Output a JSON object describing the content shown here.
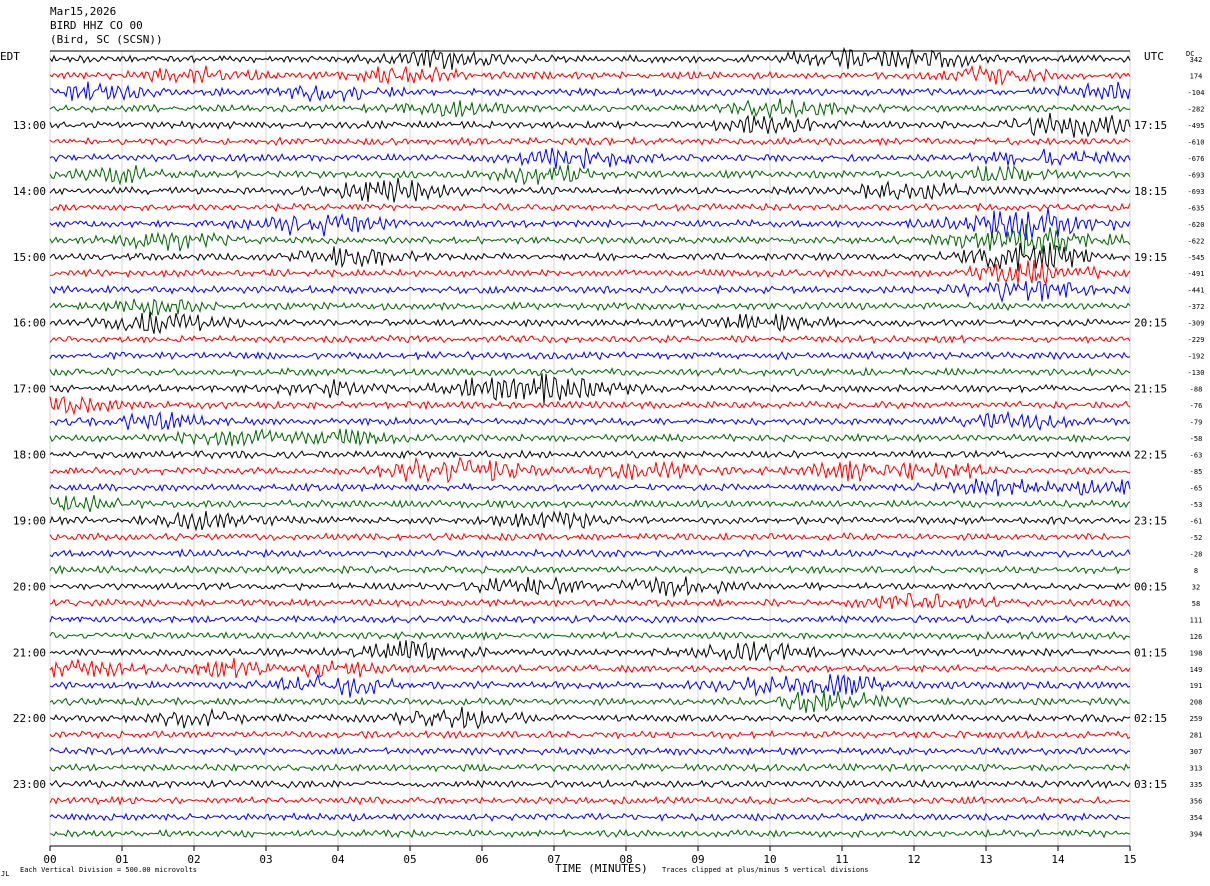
{
  "header": {
    "date": "Mar15,2026",
    "station": "BIRD HHZ CO 00",
    "location": "(Bird, SC (SCSN))"
  },
  "left_zone": "EDT",
  "right_zone": "UTC",
  "dc_label": "DC",
  "footer": {
    "left": "Each Vertical Division =  500.00 microvolts",
    "right": "Traces clipped at plus/minus 5 vertical divisions"
  },
  "mark": "JL",
  "colors": {
    "black": "#000000",
    "red": "#ff0000",
    "blue": "#0000ff",
    "green": "#006400",
    "grid": "#bbbbbb"
  },
  "chart_data": {
    "type": "line",
    "title": "",
    "xlabel": "TIME (MINUTES)",
    "xlim": [
      0,
      15
    ],
    "x_ticks": [
      "00",
      "01",
      "02",
      "03",
      "04",
      "05",
      "06",
      "07",
      "08",
      "09",
      "10",
      "11",
      "12",
      "13",
      "14",
      "15"
    ],
    "traces_per_hour": 4,
    "trace_minutes": 15,
    "trace_color_cycle": [
      "black",
      "red",
      "blue",
      "green"
    ],
    "left_hour_labels": [
      "13:00",
      "14:00",
      "15:00",
      "16:00",
      "17:00",
      "18:00",
      "19:00",
      "20:00",
      "21:00",
      "22:00",
      "23:00"
    ],
    "right_hour_labels": [
      "17:15",
      "18:15",
      "19:15",
      "20:15",
      "21:15",
      "22:15",
      "23:15",
      "00:15",
      "01:15",
      "02:15",
      "03:15"
    ],
    "dc_offsets": [
      342,
      174,
      -104,
      -282,
      -495,
      -610,
      -676,
      -693,
      -693,
      -635,
      -620,
      -622,
      -545,
      -491,
      -441,
      -372,
      -309,
      -229,
      -192,
      -130,
      -88,
      -76,
      -79,
      -58,
      -63,
      -85,
      -65,
      -53,
      -61,
      -52,
      -28,
      8,
      32,
      58,
      111,
      126,
      198,
      149,
      191,
      208,
      259,
      281,
      307,
      313,
      335,
      356,
      354,
      394
    ],
    "bursts": [
      {
        "trace": 0,
        "minute": 5.5,
        "strength": 1.6
      },
      {
        "trace": 0,
        "minute": 11.0,
        "strength": 1.7
      },
      {
        "trace": 0,
        "minute": 12.3,
        "strength": 1.3
      },
      {
        "trace": 1,
        "minute": 2.0,
        "strength": 1.3
      },
      {
        "trace": 1,
        "minute": 4.9,
        "strength": 1.4
      },
      {
        "trace": 1,
        "minute": 13.1,
        "strength": 1.5
      },
      {
        "trace": 2,
        "minute": 0.6,
        "strength": 1.4
      },
      {
        "trace": 2,
        "minute": 3.9,
        "strength": 1.4
      },
      {
        "trace": 2,
        "minute": 14.7,
        "strength": 1.5
      },
      {
        "trace": 3,
        "minute": 10.2,
        "strength": 1.8
      },
      {
        "trace": 3,
        "minute": 5.6,
        "strength": 1.2
      },
      {
        "trace": 4,
        "minute": 10.0,
        "strength": 1.3
      },
      {
        "trace": 4,
        "minute": 14.2,
        "strength": 2.2
      },
      {
        "trace": 6,
        "minute": 7.3,
        "strength": 1.9
      },
      {
        "trace": 6,
        "minute": 13.9,
        "strength": 1.6
      },
      {
        "trace": 7,
        "minute": 1.0,
        "strength": 1.2
      },
      {
        "trace": 7,
        "minute": 6.9,
        "strength": 1.5
      },
      {
        "trace": 7,
        "minute": 13.2,
        "strength": 1.3
      },
      {
        "trace": 8,
        "minute": 4.7,
        "strength": 2.0
      },
      {
        "trace": 8,
        "minute": 11.9,
        "strength": 1.8
      },
      {
        "trace": 10,
        "minute": 3.7,
        "strength": 2.1
      },
      {
        "trace": 10,
        "minute": 13.6,
        "strength": 3.0
      },
      {
        "trace": 11,
        "minute": 1.7,
        "strength": 1.5
      },
      {
        "trace": 11,
        "minute": 13.6,
        "strength": 3.0
      },
      {
        "trace": 12,
        "minute": 4.2,
        "strength": 1.6
      },
      {
        "trace": 12,
        "minute": 13.6,
        "strength": 2.5
      },
      {
        "trace": 13,
        "minute": 13.6,
        "strength": 2.0
      },
      {
        "trace": 14,
        "minute": 13.6,
        "strength": 2.0
      },
      {
        "trace": 15,
        "minute": 1.5,
        "strength": 1.2
      },
      {
        "trace": 16,
        "minute": 1.5,
        "strength": 1.8
      },
      {
        "trace": 16,
        "minute": 10.0,
        "strength": 1.4
      },
      {
        "trace": 20,
        "minute": 7.0,
        "strength": 2.4
      },
      {
        "trace": 20,
        "minute": 3.8,
        "strength": 1.3
      },
      {
        "trace": 20,
        "minute": 6.0,
        "strength": 1.3
      },
      {
        "trace": 21,
        "minute": 0.3,
        "strength": 1.3
      },
      {
        "trace": 22,
        "minute": 1.5,
        "strength": 1.3
      },
      {
        "trace": 22,
        "minute": 13.4,
        "strength": 1.4
      },
      {
        "trace": 23,
        "minute": 2.5,
        "strength": 1.5
      },
      {
        "trace": 23,
        "minute": 4.0,
        "strength": 1.3
      },
      {
        "trace": 25,
        "minute": 5.3,
        "strength": 1.8
      },
      {
        "trace": 25,
        "minute": 6.0,
        "strength": 1.5
      },
      {
        "trace": 25,
        "minute": 8.3,
        "strength": 1.5
      },
      {
        "trace": 25,
        "minute": 11.2,
        "strength": 1.6
      },
      {
        "trace": 25,
        "minute": 12.3,
        "strength": 1.5
      },
      {
        "trace": 26,
        "minute": 13.0,
        "strength": 1.5
      },
      {
        "trace": 26,
        "minute": 14.9,
        "strength": 1.5
      },
      {
        "trace": 27,
        "minute": 0.2,
        "strength": 1.5
      },
      {
        "trace": 28,
        "minute": 2.2,
        "strength": 1.5
      },
      {
        "trace": 28,
        "minute": 7.0,
        "strength": 1.5
      },
      {
        "trace": 32,
        "minute": 6.6,
        "strength": 1.5
      },
      {
        "trace": 32,
        "minute": 8.7,
        "strength": 1.5
      },
      {
        "trace": 33,
        "minute": 12.2,
        "strength": 1.8
      },
      {
        "trace": 36,
        "minute": 5.1,
        "strength": 1.8
      },
      {
        "trace": 36,
        "minute": 9.8,
        "strength": 1.6
      },
      {
        "trace": 37,
        "minute": 0.4,
        "strength": 1.6
      },
      {
        "trace": 37,
        "minute": 2.6,
        "strength": 1.4
      },
      {
        "trace": 37,
        "minute": 4.0,
        "strength": 1.4
      },
      {
        "trace": 38,
        "minute": 3.9,
        "strength": 2.0
      },
      {
        "trace": 38,
        "minute": 10.0,
        "strength": 1.6
      },
      {
        "trace": 38,
        "minute": 11.0,
        "strength": 1.5
      },
      {
        "trace": 39,
        "minute": 10.8,
        "strength": 2.0
      },
      {
        "trace": 40,
        "minute": 5.7,
        "strength": 1.8
      },
      {
        "trace": 40,
        "minute": 2.0,
        "strength": 1.3
      }
    ]
  }
}
